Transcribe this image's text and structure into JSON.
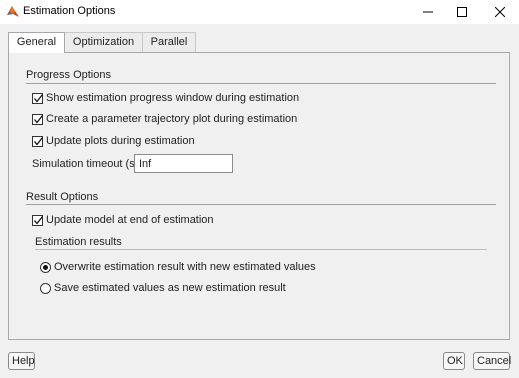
{
  "window": {
    "title": "Estimation Options",
    "icon": "matlab-icon",
    "controls": [
      "minimize-icon",
      "maximize-icon",
      "close-icon"
    ]
  },
  "tabs": [
    {
      "label": "General",
      "active": true
    },
    {
      "label": "Optimization",
      "active": false
    },
    {
      "label": "Parallel",
      "active": false
    }
  ],
  "progress": {
    "title": "Progress Options",
    "checks": [
      {
        "label": "Show estimation progress window during estimation",
        "checked": true
      },
      {
        "label": "Create a parameter trajectory plot during estimation",
        "checked": true
      },
      {
        "label": "Update plots during estimation",
        "checked": true
      }
    ],
    "timeout_label": "Simulation timeout (s)",
    "timeout_value": "Inf"
  },
  "result": {
    "title": "Result Options",
    "update_model": {
      "label": "Update model at end of estimation",
      "checked": true
    },
    "estimation_results_title": "Estimation results",
    "radios": [
      {
        "label": "Overwrite estimation result with new estimated values",
        "selected": true
      },
      {
        "label": "Save estimated values as new estimation result",
        "selected": false
      }
    ]
  },
  "footer": {
    "help": "Help",
    "ok": "OK",
    "cancel": "Cancel"
  }
}
